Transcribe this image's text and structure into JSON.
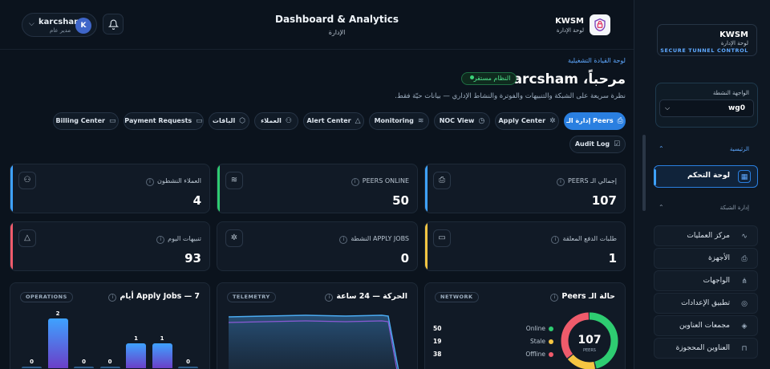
{
  "topbar": {
    "user_name": "karcsham",
    "user_role": "مدير عام",
    "avatar_letter": "K",
    "page_title": "Dashboard & Analytics",
    "page_subtitle": "الإدارة",
    "brand": "KWSM",
    "brand_subtitle": "لوحة الإدارة"
  },
  "header": {
    "breadcrumb": "لوحة القيادة التشغيلية",
    "welcome": "مرحباً، karcsham",
    "status_badge": "النظام مستقر",
    "description": "نظرة سريعة على الشبكة والتنبيهات والفوترة والنشاط الإداري — بيانات حيّة فقط."
  },
  "quick_actions": [
    {
      "label": "إدارة الـ Peers",
      "icon": "⎙"
    },
    {
      "label": "Apply Center",
      "icon": "✲"
    },
    {
      "label": "NOC View",
      "icon": "◷"
    },
    {
      "label": "Monitoring",
      "icon": "≋"
    },
    {
      "label": "Alert Center",
      "icon": "△"
    },
    {
      "label": "العملاء",
      "icon": "⚇"
    },
    {
      "label": "الباقات",
      "icon": "⬡"
    },
    {
      "label": "Payment Requests",
      "icon": "▭"
    },
    {
      "label": "Billing Center",
      "icon": "▭"
    },
    {
      "label": "Audit Log",
      "icon": "☑"
    }
  ],
  "stat_cards": [
    {
      "label": "إجمالي الـ PEERS",
      "value": "107",
      "icon": "⎙",
      "color": "#3ea2ff"
    },
    {
      "label": "PEERS ONLINE",
      "value": "50",
      "icon": "≋",
      "color": "#2ecc71"
    },
    {
      "label": "العملاء النشطون",
      "value": "4",
      "icon": "⚇",
      "color": "#3ea2ff"
    },
    {
      "label": "طلبات الدفع المعلقة",
      "value": "1",
      "icon": "▭",
      "color": "#f5c542"
    },
    {
      "label": "APPLY JOBS النشطة",
      "value": "0",
      "icon": "✲",
      "color": "#111a26"
    },
    {
      "label": "تنبيهات اليوم",
      "value": "93",
      "icon": "△",
      "color": "#ef5b6b"
    }
  ],
  "panels": {
    "network": {
      "tag": "NETWORK",
      "title": "حالة الـ Peers",
      "total": "107",
      "total_label": "PEERS"
    },
    "telemetry": {
      "tag": "TELEMETRY",
      "title": "الحركة — 24 ساعة"
    },
    "operations": {
      "tag": "OPERATIONS",
      "title": "Apply Jobs — 7 أيام"
    }
  },
  "chart_data": [
    {
      "type": "pie",
      "title": "حالة الـ Peers",
      "categories": [
        "Online",
        "Stale",
        "Offline"
      ],
      "values": [
        50,
        19,
        38
      ],
      "colors": [
        "#2ecc71",
        "#f5c542",
        "#ef5b6b"
      ]
    },
    {
      "type": "bar",
      "title": "Apply Jobs — 7 أيام",
      "values": [
        0,
        2,
        0,
        0,
        1,
        1,
        0
      ]
    },
    {
      "type": "area",
      "title": "الحركة — 24 ساعة"
    }
  ],
  "sidebar": {
    "brand": "KWSM",
    "brand_subtitle": "لوحة الإدارة",
    "brand_tagline": "SECURE TUNNEL CONTROL",
    "interface_label": "الواجهة النشطة",
    "interface_value": "wg0",
    "section_home": "الرئيسية",
    "section_network": "إدارة الشبكة",
    "items": [
      {
        "label": "لوحة التحكم",
        "icon": "▦"
      },
      {
        "label": "مركز العمليات",
        "icon": "∿"
      },
      {
        "label": "الأجهزة",
        "icon": "⎙"
      },
      {
        "label": "الواجهات",
        "icon": "⋔"
      },
      {
        "label": "تطبيق الإعدادات",
        "icon": "◎"
      },
      {
        "label": "مجمعات العناوين",
        "icon": "◈"
      },
      {
        "label": "العناوين المحجوزة",
        "icon": "⊓"
      }
    ]
  }
}
